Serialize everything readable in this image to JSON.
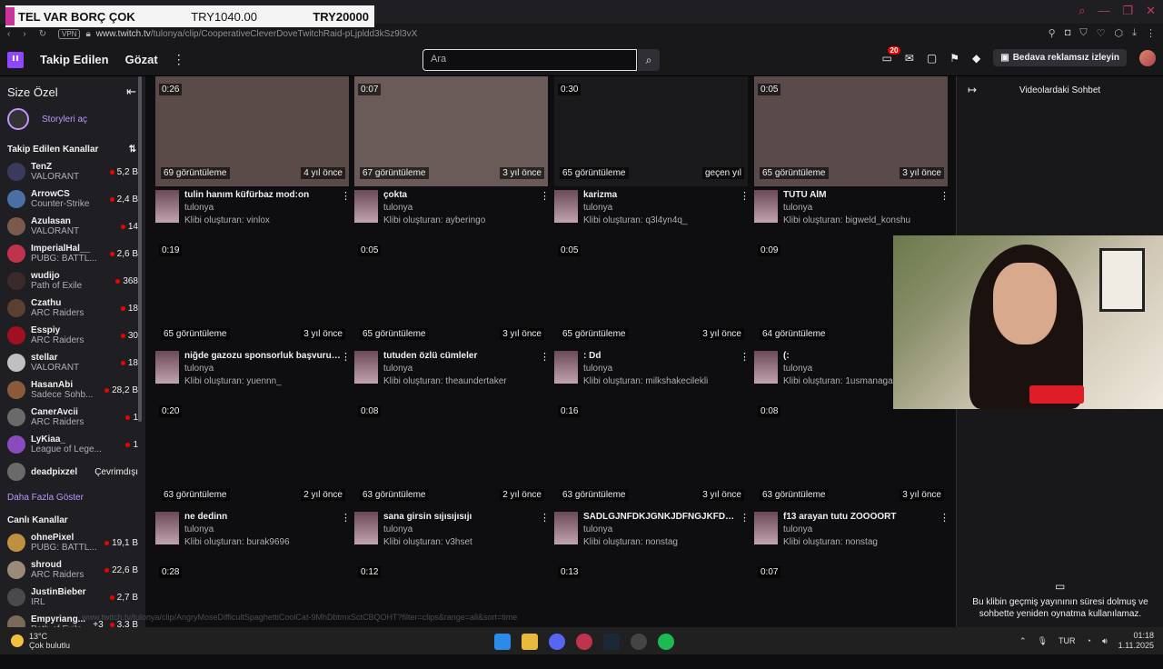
{
  "overlay": {
    "text": "TEL VAR BORÇ ÇOK",
    "amount": "TRY1040.00",
    "goal": "TRY20000"
  },
  "browser": {
    "vpn": "VPN",
    "url_host": "www.twitch.tv",
    "url_path": "/tulonya/clip/CooperativeCleverDoveTwitchRaid-pLjpldd3kSz9l3vX",
    "status_link": "www.twitch.tv/tulonya/clip/AngryMoseDifficultSpaghettiCoolCat-9MhDbtmxSctCBQOHT?filter=clips&range=all&sort=time"
  },
  "nav": {
    "following": "Takip Edilen",
    "browse": "Gözat",
    "search_placeholder": "Ara",
    "notif_count": "20",
    "promo": "Bedava reklamsız izleyin"
  },
  "sidebar": {
    "title": "Size Özel",
    "stories": "Storyleri aç",
    "followed_title": "Takip Edilen Kanallar",
    "followed": [
      {
        "name": "TenZ",
        "game": "VALORANT",
        "viewers": "5,2 B",
        "color": "#3a3a5c"
      },
      {
        "name": "ArrowCS",
        "game": "Counter-Strike",
        "viewers": "2,4 B",
        "color": "#4a6fa5"
      },
      {
        "name": "Azulasan",
        "game": "VALORANT",
        "viewers": "14",
        "color": "#7a5a4a"
      },
      {
        "name": "ImperialHal__",
        "game": "PUBG: BATTL...",
        "viewers": "2,6 B",
        "color": "#c0334d"
      },
      {
        "name": "wudijo",
        "game": "Path of Exile",
        "viewers": "368",
        "color": "#3a2a2a"
      },
      {
        "name": "Czathu",
        "game": "ARC Raiders",
        "viewers": "18",
        "color": "#5a4030"
      },
      {
        "name": "Esspiy",
        "game": "ARC Raiders",
        "viewers": "30",
        "color": "#a01020"
      },
      {
        "name": "stellar",
        "game": "VALORANT",
        "viewers": "18",
        "color": "#c0c0c0"
      },
      {
        "name": "HasanAbi",
        "game": "Sadece Sohb...",
        "viewers": "28,2 B",
        "color": "#8a5a3a"
      },
      {
        "name": "CanerAvcii",
        "game": "ARC Raiders",
        "viewers": "1",
        "color": "#6a6a6a"
      },
      {
        "name": "LyKiaa_",
        "game": "League of Lege...",
        "viewers": "1",
        "color": "#8a4ac0"
      }
    ],
    "offline_channel": {
      "name": "deadpixzel",
      "status": "Çevrimdışı"
    },
    "show_more": "Daha Fazla Göster",
    "live_title": "Canlı Kanallar",
    "live": [
      {
        "name": "ohnePixel",
        "game": "PUBG: BATTL...",
        "viewers": "19,1 B",
        "color": "#c09040"
      },
      {
        "name": "shroud",
        "game": "ARC Raiders",
        "viewers": "22,6 B",
        "color": "#9a8a7a"
      },
      {
        "name": "JustinBieber",
        "game": "IRL",
        "viewers": "2,7 B",
        "color": "#4a4a4a"
      },
      {
        "name": "Empyriang...",
        "game": "Path of Exile",
        "viewers": "3,3 B",
        "extra": "+3",
        "color": "#7a6a5a"
      }
    ]
  },
  "clips": [
    {
      "dur": "0:26",
      "views": "69 görüntüleme",
      "ago": "4 yıl önce",
      "title": "tulin hanım küfürbaz mod:on",
      "channel": "tulonya",
      "by": "Klibi oluşturan: vinlox",
      "thumb": "#5a4a48"
    },
    {
      "dur": "0:07",
      "views": "67 görüntüleme",
      "ago": "3 yıl önce",
      "title": "çokta",
      "channel": "tulonya",
      "by": "Klibi oluşturan: ayberingo",
      "thumb": "#6a5a58"
    },
    {
      "dur": "0:30",
      "views": "65 görüntüleme",
      "ago": "geçen yıl",
      "title": "karizma",
      "channel": "tulonya",
      "by": "Klibi oluşturan: q3l4yn4q_",
      "thumb": "#1a1a1c"
    },
    {
      "dur": "0:05",
      "views": "65 görüntüleme",
      "ago": "3 yıl önce",
      "title": "TÜTÜ AİM",
      "channel": "tulonya",
      "by": "Klibi oluşturan: bigweld_konshu",
      "thumb": "#5a4a4a"
    },
    {
      "dur": "0:19",
      "views": "65 görüntüleme",
      "ago": "3 yıl önce",
      "title": "niğde gazozu sponsorluk başvurusu",
      "channel": "tulonya",
      "by": "Klibi oluşturan: yuennn_",
      "thumb": "#0e0e10"
    },
    {
      "dur": "0:05",
      "views": "65 görüntüleme",
      "ago": "3 yıl önce",
      "title": "tutuden özlü cümleler",
      "channel": "tulonya",
      "by": "Klibi oluşturan: theaundertaker",
      "thumb": "#0e0e10"
    },
    {
      "dur": "0:05",
      "views": "65 görüntüleme",
      "ago": "3 yıl önce",
      "title": ": Dd",
      "channel": "tulonya",
      "by": "Klibi oluşturan: milkshakecilekli",
      "thumb": "#0e0e10"
    },
    {
      "dur": "0:09",
      "views": "64 görüntüleme",
      "ago": "",
      "title": "(:",
      "channel": "tulonya",
      "by": "Klibi oluşturan: 1usmanaga1",
      "thumb": "#0e0e10"
    },
    {
      "dur": "0:20",
      "views": "63 görüntüleme",
      "ago": "2 yıl önce",
      "title": "ne dedinn",
      "channel": "tulonya",
      "by": "Klibi oluşturan: burak9696",
      "thumb": "#0e0e10"
    },
    {
      "dur": "0:08",
      "views": "63 görüntüleme",
      "ago": "2 yıl önce",
      "title": "sana girsin sıjısıjısıjı",
      "channel": "tulonya",
      "by": "Klibi oluşturan: v3hset",
      "thumb": "#0e0e10"
    },
    {
      "dur": "0:16",
      "views": "63 görüntüleme",
      "ago": "3 yıl önce",
      "title": "SADLGJNFDKJGNKJDFNGJKFDNS...",
      "channel": "tulonya",
      "by": "Klibi oluşturan: nonstag",
      "thumb": "#0e0e10"
    },
    {
      "dur": "0:08",
      "views": "63 görüntüleme",
      "ago": "3 yıl önce",
      "title": "f13 arayan tutu ZOOOORT",
      "channel": "tulonya",
      "by": "Klibi oluşturan: nonstag",
      "thumb": "#0e0e10"
    },
    {
      "dur": "0:28",
      "views": "",
      "ago": "",
      "title": "",
      "channel": "",
      "by": "",
      "thumb": "#0e0e10"
    },
    {
      "dur": "0:12",
      "views": "",
      "ago": "",
      "title": "",
      "channel": "",
      "by": "",
      "thumb": "#0e0e10"
    },
    {
      "dur": "0:13",
      "views": "",
      "ago": "",
      "title": "",
      "channel": "",
      "by": "",
      "thumb": "#0e0e10"
    },
    {
      "dur": "0:07",
      "views": "",
      "ago": "",
      "title": "",
      "channel": "",
      "by": "",
      "thumb": "#0e0e10"
    }
  ],
  "chat": {
    "title": "Videolardaki Sohbet",
    "note_line1": "Bu klibin geçmiş yayınının süresi dolmuş ve",
    "note_line2": "sohbette yeniden oynatma kullanılamaz."
  },
  "taskbar": {
    "temp": "13°C",
    "weather": "Çok bulutlu",
    "lang": "TUR",
    "time": "01:18",
    "date": "1.11.2025"
  }
}
